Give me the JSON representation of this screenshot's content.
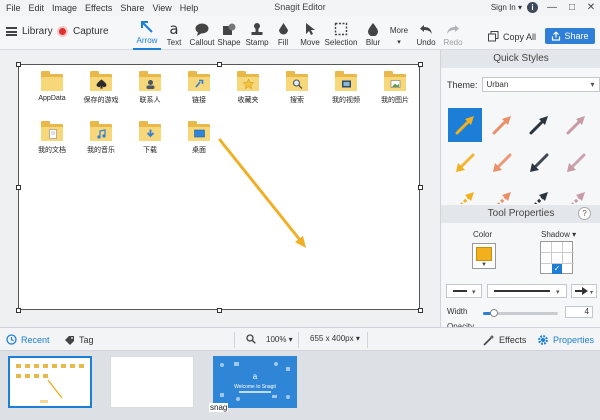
{
  "app": {
    "title": "Snagit Editor"
  },
  "menu": [
    "File",
    "Edit",
    "Image",
    "Effects",
    "Share",
    "View",
    "Help"
  ],
  "account": {
    "signin": "Sign In ▾",
    "info": "i"
  },
  "window_controls": [
    "—",
    "□",
    "✕"
  ],
  "toolbar": {
    "library": "Library",
    "capture": "Capture",
    "tools": [
      {
        "label": "Arrow",
        "icon": "arrow-tool-icon",
        "active": true
      },
      {
        "label": "Text",
        "icon": "text-tool-icon"
      },
      {
        "label": "Callout",
        "icon": "callout-tool-icon"
      },
      {
        "label": "Shape",
        "icon": "shape-tool-icon"
      },
      {
        "label": "Stamp",
        "icon": "stamp-tool-icon"
      },
      {
        "label": "Fill",
        "icon": "fill-tool-icon"
      },
      {
        "label": "Move",
        "icon": "move-tool-icon"
      },
      {
        "label": "Selection",
        "icon": "selection-tool-icon"
      },
      {
        "label": "Blur",
        "icon": "blur-tool-icon"
      },
      {
        "label": "More",
        "icon": "more-tools-icon"
      },
      {
        "label": "Undo",
        "icon": "undo-icon"
      },
      {
        "label": "Redo",
        "icon": "redo-icon",
        "disabled": true
      }
    ],
    "copy_all": "Copy All",
    "share": "Share"
  },
  "canvas": {
    "icons": [
      {
        "label": "AppData",
        "overlay": "none"
      },
      {
        "label": "保存的游戏",
        "overlay": "spade"
      },
      {
        "label": "联系人",
        "overlay": "contact"
      },
      {
        "label": "链接",
        "overlay": "link"
      },
      {
        "label": "收藏夹",
        "overlay": "star"
      },
      {
        "label": "搜索",
        "overlay": "search"
      },
      {
        "label": "我的视频",
        "overlay": "film"
      },
      {
        "label": "我的图片",
        "overlay": "picture"
      },
      {
        "label": "我的文档",
        "overlay": "doc"
      },
      {
        "label": "我的音乐",
        "overlay": "music"
      },
      {
        "label": "下载",
        "overlay": "download"
      },
      {
        "label": "桌面",
        "overlay": "desktop"
      }
    ]
  },
  "quick_styles": {
    "header": "Quick Styles",
    "theme_label": "Theme:",
    "theme_value": "Urban",
    "arrow_colors": [
      "#f2b01e",
      "#e9906a",
      "#2b3540",
      "#c79aa4"
    ]
  },
  "tool_properties": {
    "header": "Tool Properties",
    "help": "?",
    "color_label": "Color",
    "color_value": "#f2b01e",
    "shadow_label": "Shadow ▾",
    "width_label": "Width",
    "width_value": "4",
    "width_fraction": 0.15,
    "opacity_label": "Opacity"
  },
  "bottom": {
    "recent": "Recent",
    "tag": "Tag",
    "zoom": "100% ▾",
    "size": "655 x 400px ▾",
    "effects": "Effects",
    "properties": "Properties"
  },
  "tray": {
    "snag_label": "snag",
    "welcome_title": "Welcome to Snagit"
  }
}
